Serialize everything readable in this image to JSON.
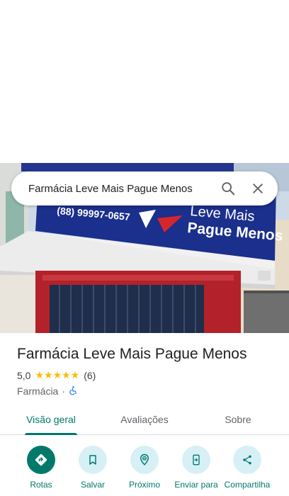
{
  "search": {
    "query": "Farmácia Leve Mais Pague Menos",
    "search_icon": "search-icon",
    "close_icon": "close-icon"
  },
  "photo": {
    "sign_phone": "(88) 99997-0657",
    "sign_line1": "Leve Mais",
    "sign_line2": "Pague Menos"
  },
  "place": {
    "name": "Farmácia Leve Mais Pague Menos",
    "rating": "5,0",
    "stars": "★★★★★",
    "review_count": "(6)",
    "category": "Farmácia",
    "separator": "·",
    "accessibility_icon": "wheelchair-icon"
  },
  "tabs": [
    {
      "label": "Visão geral",
      "active": true
    },
    {
      "label": "Avaliações",
      "active": false
    },
    {
      "label": "Sobre",
      "active": false
    }
  ],
  "actions": [
    {
      "label": "Rotas",
      "icon": "directions-icon"
    },
    {
      "label": "Salvar",
      "icon": "bookmark-icon"
    },
    {
      "label": "Próximo",
      "icon": "nearby-icon"
    },
    {
      "label": "Enviar para",
      "icon": "send-to-phone-icon"
    },
    {
      "label": "Compartilha",
      "icon": "share-icon"
    }
  ],
  "colors": {
    "accent": "#00796b",
    "action_bg": "#d6f0f6",
    "star": "#fbbc04",
    "sign_blue": "#1b2f8c",
    "wall_red": "#b3222a"
  }
}
